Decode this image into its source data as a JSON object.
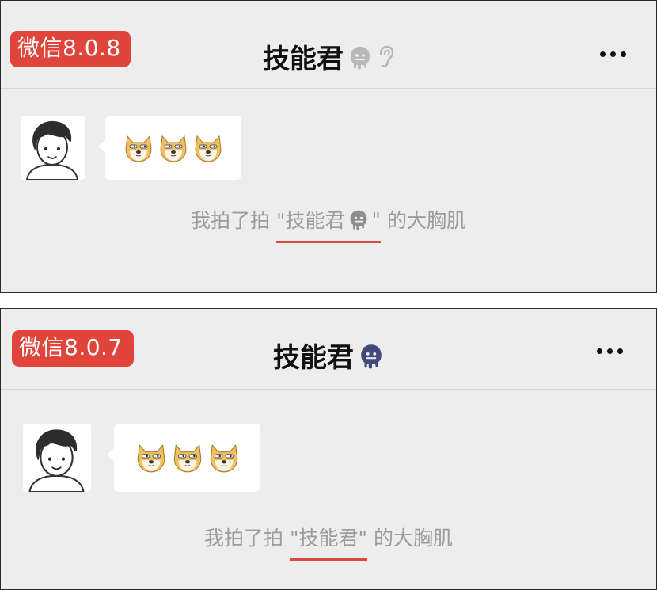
{
  "panels": [
    {
      "version_badge": "微信8.0.8",
      "title": "技能君",
      "title_icons": [
        "melting-face-icon",
        "ear-icon"
      ],
      "message_emojis": [
        "doge-emoji",
        "doge-emoji",
        "doge-emoji"
      ],
      "system_message": {
        "prefix": "我拍了拍 ",
        "quoted_name": "\"技能君",
        "quoted_close": "\"",
        "suffix": " 的大胸肌",
        "quoted_icon": "melting-face-icon"
      }
    },
    {
      "version_badge": "微信8.0.7",
      "title": "技能君",
      "title_icons": [
        "melting-face-icon"
      ],
      "message_emojis": [
        "doge-emoji",
        "doge-emoji",
        "doge-emoji"
      ],
      "system_message": {
        "prefix": "我拍了拍 ",
        "quoted_name": "\"技能君\"",
        "suffix": " 的大胸肌"
      }
    }
  ],
  "colors": {
    "badge_bg": "#e0443a",
    "underline": "#d94a3d",
    "chat_bg": "#ededed",
    "system_text": "#9b9b9b",
    "melting_face_gray": "#b8b8b8",
    "melting_face_blue": "#3f4a7a"
  }
}
